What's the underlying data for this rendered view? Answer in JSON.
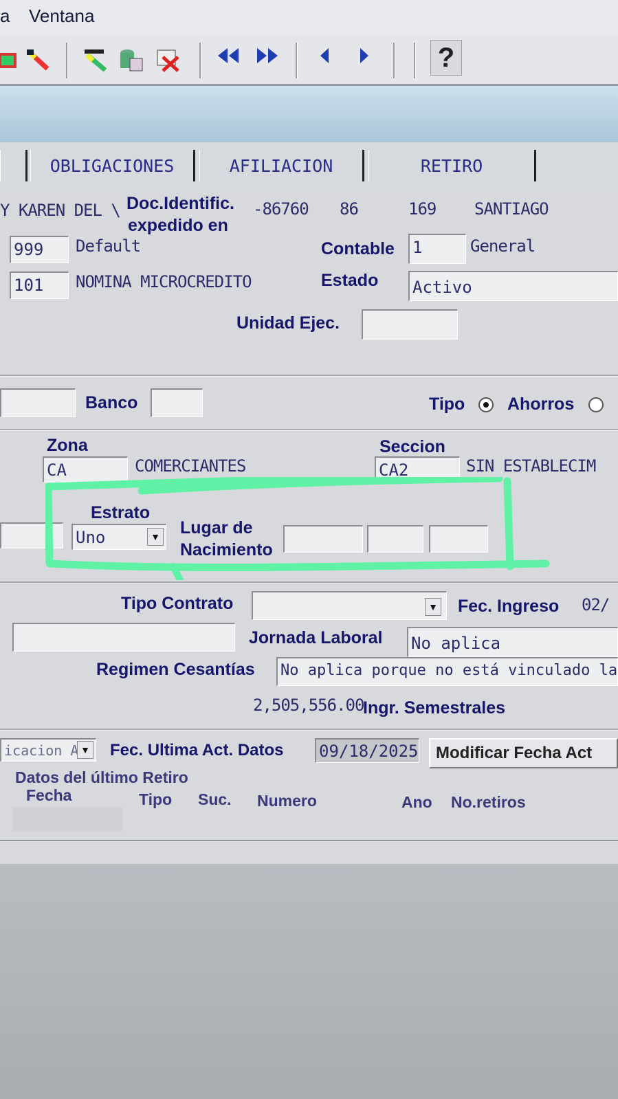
{
  "menu": {
    "partial_item": "a",
    "ventana": "Ventana"
  },
  "toolbar": {
    "help": "?"
  },
  "tabs": {
    "partial": "",
    "obligaciones": "OBLIGACIONES",
    "afiliacion": "AFILIACION",
    "retiro": "RETIRO"
  },
  "header": {
    "name_partial": "Y KAREN DEL \\",
    "doc_label_1": "Doc.Identific.",
    "doc_label_2": "expedido en",
    "doc_number": "-86760",
    "doc_v1": "86",
    "doc_v2": "169",
    "city": "SANTIAGO"
  },
  "row1": {
    "left_code": "999",
    "left_desc": "Default",
    "contable_label": "Contable",
    "contable_code": "1",
    "contable_desc": "General"
  },
  "row2": {
    "left_code": "101",
    "left_desc": "NOMINA MICROCREDITO",
    "estado_label": "Estado",
    "estado_value": "Activo"
  },
  "unidad": {
    "label": "Unidad Ejec.",
    "value": ""
  },
  "banco": {
    "label": "Banco",
    "value": "",
    "tipo_label": "Tipo",
    "tipo_option": "Ahorros"
  },
  "zona": {
    "label": "Zona",
    "code": "CA",
    "desc": "COMERCIANTES"
  },
  "seccion": {
    "label": "Seccion",
    "code": "CA2",
    "desc": "SIN ESTABLECIM"
  },
  "estrato": {
    "label": "Estrato",
    "value": "Uno"
  },
  "lugar": {
    "label_1": "Lugar de",
    "label_2": "Nacimiento",
    "v1": "",
    "v2": "",
    "v3": ""
  },
  "contrato": {
    "label": "Tipo Contrato",
    "value": "",
    "fec_ingreso_label": "Fec. Ingreso",
    "fec_ingreso_value": "02/"
  },
  "jornada": {
    "label": "Jornada Laboral",
    "value": "No aplica"
  },
  "regimen": {
    "label": "Regimen Cesantías",
    "value": "No aplica porque no está vinculado labora"
  },
  "ingresos": {
    "value": "2,505,556.00",
    "label": "Ingr. Semestrales"
  },
  "actualizacion": {
    "select_value": "icacion A",
    "label": "Fec. Ultima Act. Datos",
    "date": "09/18/2025",
    "button": "Modificar Fecha Act"
  },
  "retiro_grid": {
    "title": "Datos del último Retiro",
    "cols": [
      "Fecha",
      "Tipo",
      "Suc.",
      "Numero",
      "Ano",
      "No.retiros"
    ]
  },
  "colors": {
    "annotation": "#5ff2a6",
    "label_text": "#16166b"
  }
}
